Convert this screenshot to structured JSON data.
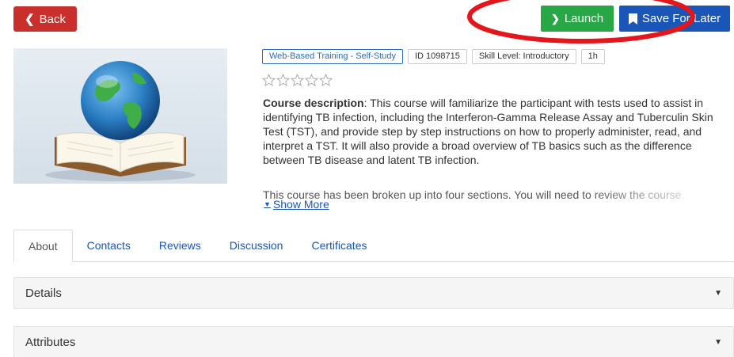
{
  "nav": {
    "back_label": "Back"
  },
  "actions": {
    "launch_label": "Launch",
    "save_label": "Save For Later"
  },
  "course": {
    "tags": [
      "Web-Based Training - Self-Study",
      "ID 1098715",
      "Skill Level: Introductory",
      "1h"
    ],
    "rating_stars_filled": 0,
    "rating_stars_total": 5,
    "description_heading": "Course description",
    "description_body": ": This course will familiarize the participant with tests used to assist in identifying TB infection, including the Interferon-Gamma Release Assay and Tuberculin Skin Test (TST), and provide step by step instructions on how to properly administer, read, and interpret a TST. It will also provide a broad overview of TB basics such as the difference between TB disease and latent TB infection.",
    "description_more": "This course has been broken up into four sections. You will need to review the course",
    "show_more_label": "Show More"
  },
  "tabs": [
    {
      "label": "About",
      "active": true
    },
    {
      "label": "Contacts",
      "active": false
    },
    {
      "label": "Reviews",
      "active": false
    },
    {
      "label": "Discussion",
      "active": false
    },
    {
      "label": "Certificates",
      "active": false
    }
  ],
  "panels": [
    {
      "label": "Details"
    },
    {
      "label": "Attributes"
    }
  ],
  "colors": {
    "back": "#c9302c",
    "launch": "#28a745",
    "save": "#1a56b8",
    "annotation": "#e3161c",
    "link": "#1a56b8"
  },
  "icons": {
    "back": "chevron-left-icon",
    "launch": "chevron-right-icon",
    "save": "bookmark-icon",
    "star": "star-outline-icon",
    "show_more": "caret-down-icon",
    "panel": "caret-down-icon"
  }
}
